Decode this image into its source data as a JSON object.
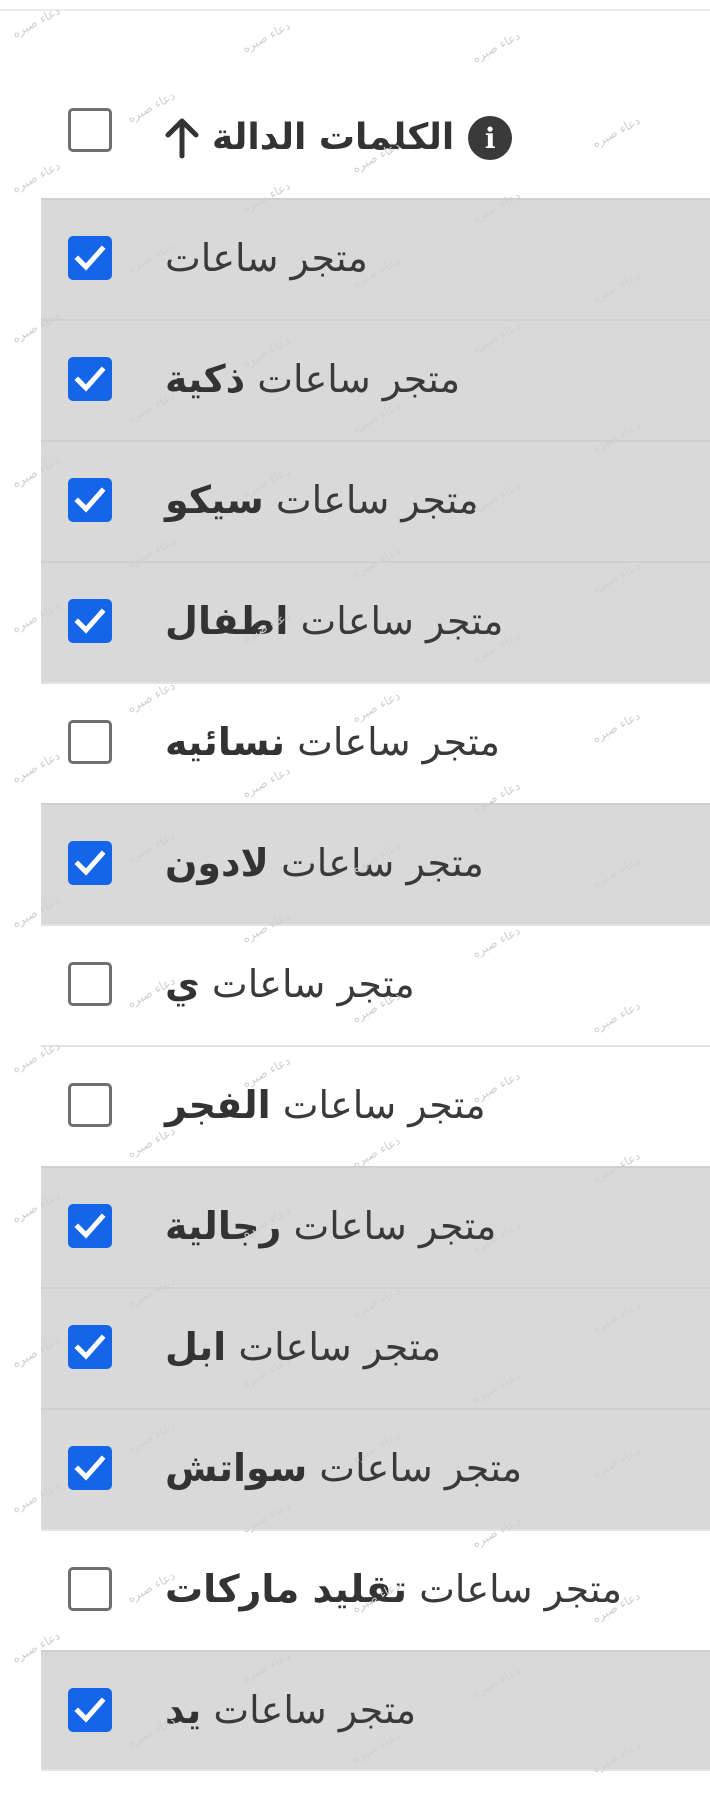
{
  "header": {
    "title": "الكلمات الدالة",
    "sort_icon": "arrow-up-icon",
    "info_icon": "info-icon",
    "info_glyph": "i",
    "select_all_checked": false
  },
  "keywords": [
    {
      "base": "متجر ساعات",
      "suffix": "",
      "checked": true
    },
    {
      "base": "متجر ساعات",
      "suffix": "ذكية",
      "checked": true
    },
    {
      "base": "متجر ساعات",
      "suffix": "سيكو",
      "checked": true
    },
    {
      "base": "متجر ساعات",
      "suffix": "اطفال",
      "checked": true
    },
    {
      "base": "متجر ساعات",
      "suffix": "نسائيه",
      "checked": false
    },
    {
      "base": "متجر ساعات",
      "suffix": "لادون",
      "checked": true
    },
    {
      "base": "متجر ساعات",
      "suffix": "ي",
      "checked": false
    },
    {
      "base": "متجر ساعات",
      "suffix": "الفجر",
      "checked": false
    },
    {
      "base": "متجر ساعات",
      "suffix": "رجالية",
      "checked": true
    },
    {
      "base": "متجر ساعات",
      "suffix": "ابل",
      "checked": true
    },
    {
      "base": "متجر ساعات",
      "suffix": "سواتش",
      "checked": true
    },
    {
      "base": "متجر ساعات",
      "suffix": "تقليد ماركات",
      "checked": false
    },
    {
      "base": "متجر ساعات",
      "suffix": "يد",
      "checked": true
    }
  ],
  "watermark": {
    "text": "دعاء صبره"
  },
  "colors": {
    "accent": "#1565e8",
    "selected_row": "#d9d9d9",
    "text": "#3a3a3a"
  }
}
